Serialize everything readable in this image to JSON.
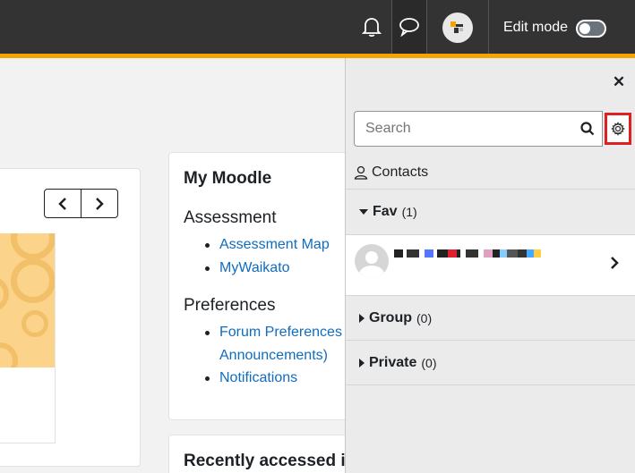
{
  "navbar": {
    "edit_mode_label": "Edit mode",
    "accent_color": "#f6a400",
    "icons": [
      "bell-icon",
      "chat-icon",
      "user-avatar"
    ]
  },
  "course_nav": {
    "prev_icon": "chevron-left-icon",
    "next_icon": "chevron-right-icon"
  },
  "my_moodle": {
    "title": "My Moodle",
    "sections": [
      {
        "heading": "Assessment",
        "links": [
          "Assessment Map",
          "MyWaikato"
        ]
      },
      {
        "heading": "Preferences",
        "links": [
          "Forum Preferences",
          "Announcements)",
          "Notifications"
        ]
      }
    ]
  },
  "recent": {
    "title": "Recently accessed ite"
  },
  "drawer": {
    "close_icon": "close-icon",
    "search_placeholder": "Search",
    "contacts_label": "Contacts",
    "groups": [
      {
        "name": "Fav",
        "count": "(1)",
        "expanded": true
      },
      {
        "name": "Group",
        "count": "(0)",
        "expanded": false
      },
      {
        "name": "Private",
        "count": "(0)",
        "expanded": false
      }
    ],
    "highlight_color": "#e02020"
  }
}
